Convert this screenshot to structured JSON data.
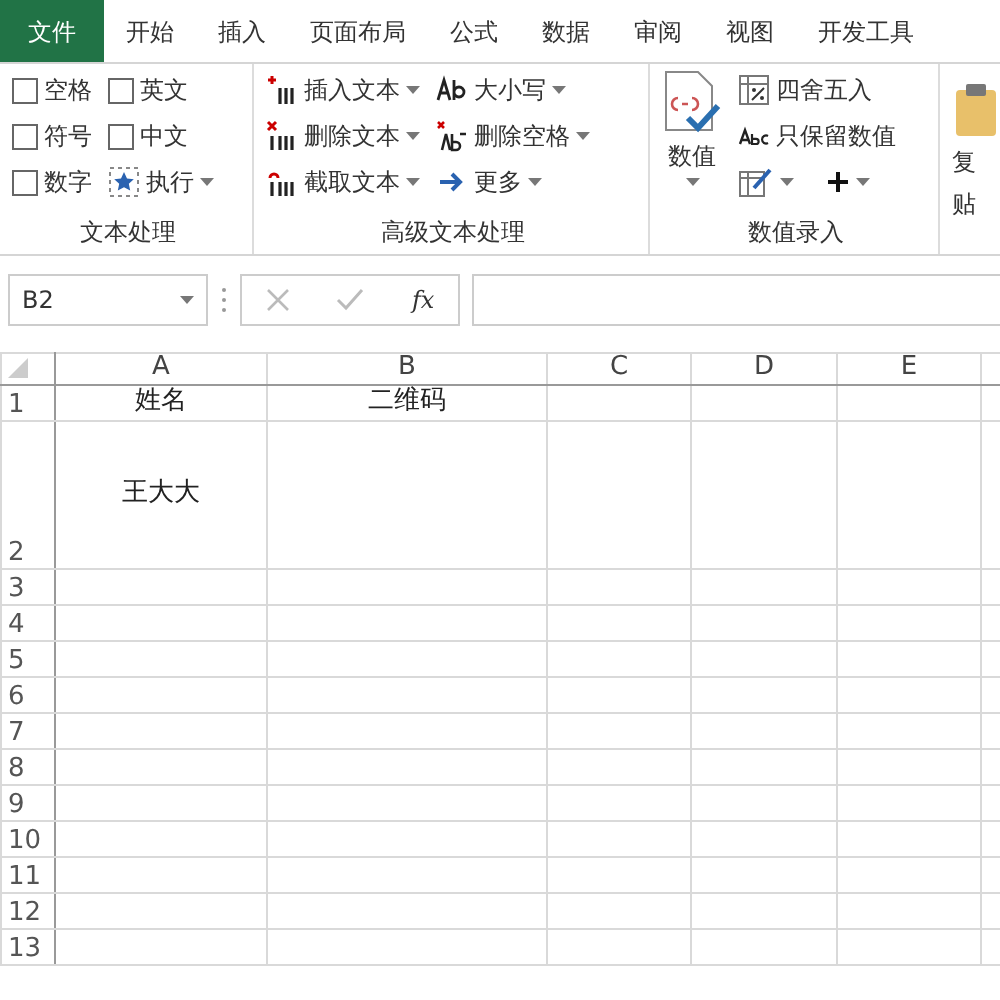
{
  "tabs": [
    {
      "label": "文件",
      "selected": true
    },
    {
      "label": "开始",
      "selected": false
    },
    {
      "label": "插入",
      "selected": false
    },
    {
      "label": "页面布局",
      "selected": false
    },
    {
      "label": "公式",
      "selected": false
    },
    {
      "label": "数据",
      "selected": false
    },
    {
      "label": "审阅",
      "selected": false
    },
    {
      "label": "视图",
      "selected": false
    },
    {
      "label": "开发工具",
      "selected": false
    }
  ],
  "ribbon": {
    "text_group": {
      "title": "文本处理",
      "checkboxes": [
        {
          "label": "空格",
          "checked": false
        },
        {
          "label": "英文",
          "checked": false
        },
        {
          "label": "符号",
          "checked": false
        },
        {
          "label": "中文",
          "checked": false
        },
        {
          "label": "数字",
          "checked": false
        }
      ],
      "run_button": "执行"
    },
    "advanced_group": {
      "title": "高级文本处理",
      "buttons": [
        {
          "label": "插入文本",
          "kind": "insert"
        },
        {
          "label": "删除文本",
          "kind": "delete"
        },
        {
          "label": "截取文本",
          "kind": "cut"
        },
        {
          "label": "大小写",
          "kind": "case"
        },
        {
          "label": "删除空格",
          "kind": "trim"
        },
        {
          "label": "更多",
          "kind": "more"
        }
      ]
    },
    "number_group": {
      "title": "数值录入",
      "big_button": "数值",
      "buttons": [
        {
          "label": "四舍五入",
          "kind": "round"
        },
        {
          "label": "只保留数值",
          "kind": "abc"
        }
      ]
    },
    "clip_group": {
      "line_1": "复",
      "line_2": "贴"
    }
  },
  "formula_bar": {
    "name_box": "B2",
    "fx": "fx"
  },
  "sheet": {
    "columns": [
      "A",
      "B",
      "C",
      "D",
      "E"
    ],
    "rows": [
      {
        "header": "1",
        "cells": [
          "姓名",
          "二维码",
          "",
          "",
          ""
        ]
      },
      {
        "header": "2",
        "cells": [
          "王大大",
          "",
          "",
          "",
          ""
        ]
      },
      {
        "header": "3"
      },
      {
        "header": "4"
      },
      {
        "header": "5"
      },
      {
        "header": "6"
      },
      {
        "header": "7"
      },
      {
        "header": "8"
      },
      {
        "header": "9"
      },
      {
        "header": "10"
      },
      {
        "header": "11"
      },
      {
        "header": "12"
      },
      {
        "header": "13"
      }
    ]
  }
}
